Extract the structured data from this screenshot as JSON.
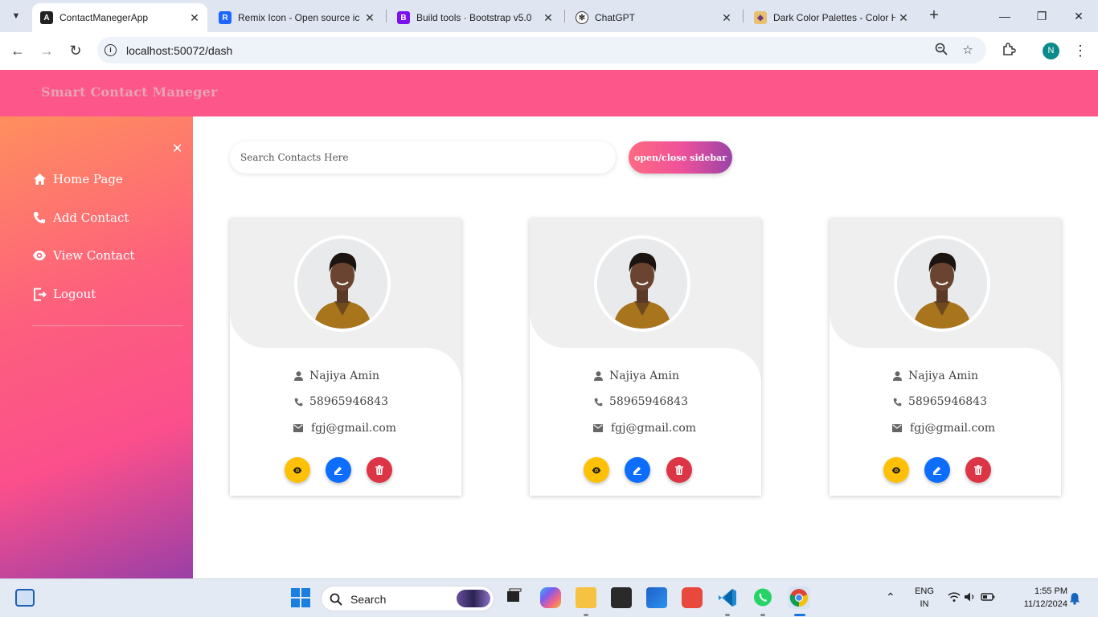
{
  "browser": {
    "tabs": [
      {
        "title": "ContactManegerApp",
        "active": true,
        "favicon": "angular-icon",
        "color": "#dd0031"
      },
      {
        "title": "Remix Icon - Open source ic",
        "active": false,
        "favicon": "remix-icon",
        "color": "#1e66ff"
      },
      {
        "title": "Build tools · Bootstrap v5.0",
        "active": false,
        "favicon": "bootstrap-icon",
        "color": "#7a11f3"
      },
      {
        "title": "ChatGPT",
        "active": false,
        "favicon": "chatgpt-icon",
        "color": "#333333"
      },
      {
        "title": "Dark Color Palettes - Color H",
        "active": false,
        "favicon": "palette-icon",
        "color": "#c8a0d0"
      }
    ],
    "url": "localhost:50072/dash"
  },
  "app": {
    "brand": "Smart Contact Maneger",
    "sidebar": {
      "items": [
        {
          "label": "Home Page",
          "icon": "home-icon"
        },
        {
          "label": "Add Contact",
          "icon": "phone-icon"
        },
        {
          "label": "View Contact",
          "icon": "eye-icon"
        },
        {
          "label": "Logout",
          "icon": "logout-icon"
        }
      ],
      "close_icon": "close-icon"
    },
    "search": {
      "placeholder": "Search Contacts Here"
    },
    "toggle_label": "open/close sidebar",
    "contacts": [
      {
        "name": "Najiya Amin",
        "phone": "58965946843",
        "email": "fgj@gmail.com"
      },
      {
        "name": "Najiya Amin",
        "phone": "58965946843",
        "email": "fgj@gmail.com"
      },
      {
        "name": "Najiya Amin",
        "phone": "58965946843",
        "email": "fgj@gmail.com"
      }
    ],
    "action_colors": {
      "view": "#ffc107",
      "edit": "#0d6efd",
      "delete": "#dc3545"
    },
    "accent": "#fc568a"
  },
  "taskbar": {
    "search_label": "Search",
    "lang_top": "ENG",
    "lang_bottom": "IN",
    "time": "1:55 PM",
    "date": "11/12/2024"
  }
}
